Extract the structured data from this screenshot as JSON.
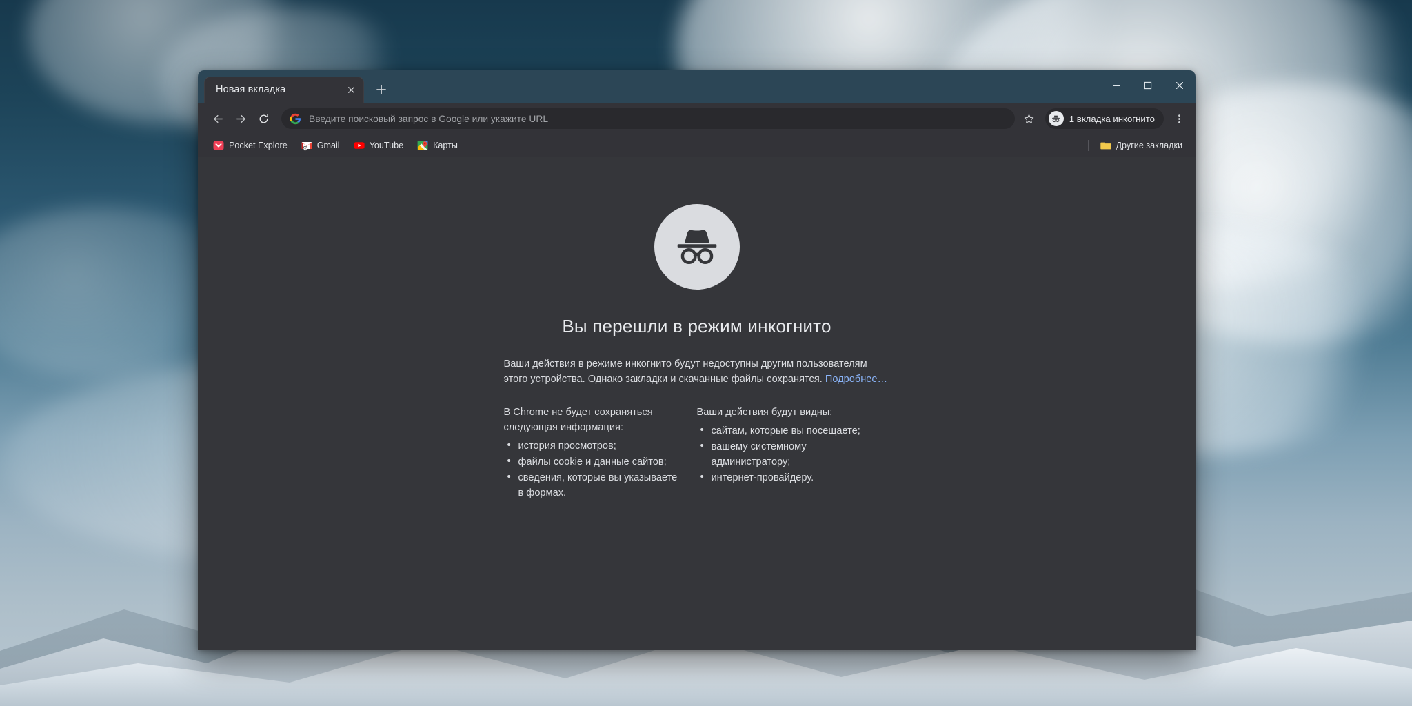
{
  "window": {
    "controls": {
      "minimize": "minimize",
      "maximize": "maximize",
      "close": "close"
    }
  },
  "tabstrip": {
    "tabs": [
      {
        "title": "Новая вкладка",
        "active": true
      }
    ],
    "new_tab_label": "+"
  },
  "toolbar": {
    "back": "Назад",
    "forward": "Вперед",
    "reload": "Обновить",
    "omnibox": {
      "placeholder": "Введите поисковый запрос в Google или укажите URL",
      "value": ""
    },
    "bookmark_star": "Добавить в закладки",
    "incognito_chip": "1 вкладка инкогнито",
    "menu": "Настройка и управление Google Chrome"
  },
  "bookmarks": {
    "items": [
      {
        "label": "Pocket Explore",
        "icon": "pocket-icon"
      },
      {
        "label": "Gmail",
        "icon": "gmail-icon"
      },
      {
        "label": "YouTube",
        "icon": "youtube-icon"
      },
      {
        "label": "Карты",
        "icon": "google-maps-icon"
      }
    ],
    "other": {
      "label": "Другие закладки",
      "icon": "folder-icon"
    }
  },
  "page": {
    "icon": "incognito-icon",
    "heading": "Вы перешли в режим инкогнито",
    "body_text": "Ваши действия в режиме инкогнито будут недоступны другим пользователям этого устройства. Однако закладки и скачанные файлы сохранятся. ",
    "learn_more": "Подробнее…",
    "columns": [
      {
        "title": "В Chrome не будет сохраняться следующая информация:",
        "items": [
          "история просмотров;",
          "файлы cookie и данные сайтов;",
          "сведения, которые вы указываете в формах."
        ]
      },
      {
        "title": "Ваши действия будут видны:",
        "items": [
          "сайтам, которые вы посещаете;",
          "вашему системному администратору;",
          "интернет-провайдеру."
        ]
      }
    ]
  },
  "colors": {
    "tabstrip_bg": "#2c4656",
    "toolbar_bg": "#333338",
    "page_bg": "#35363a",
    "text_primary": "#e8eaed",
    "text_secondary": "#dadce0",
    "link": "#8ab4f8",
    "incognito_circle": "#dadce0",
    "incognito_glyph": "#35363a"
  }
}
